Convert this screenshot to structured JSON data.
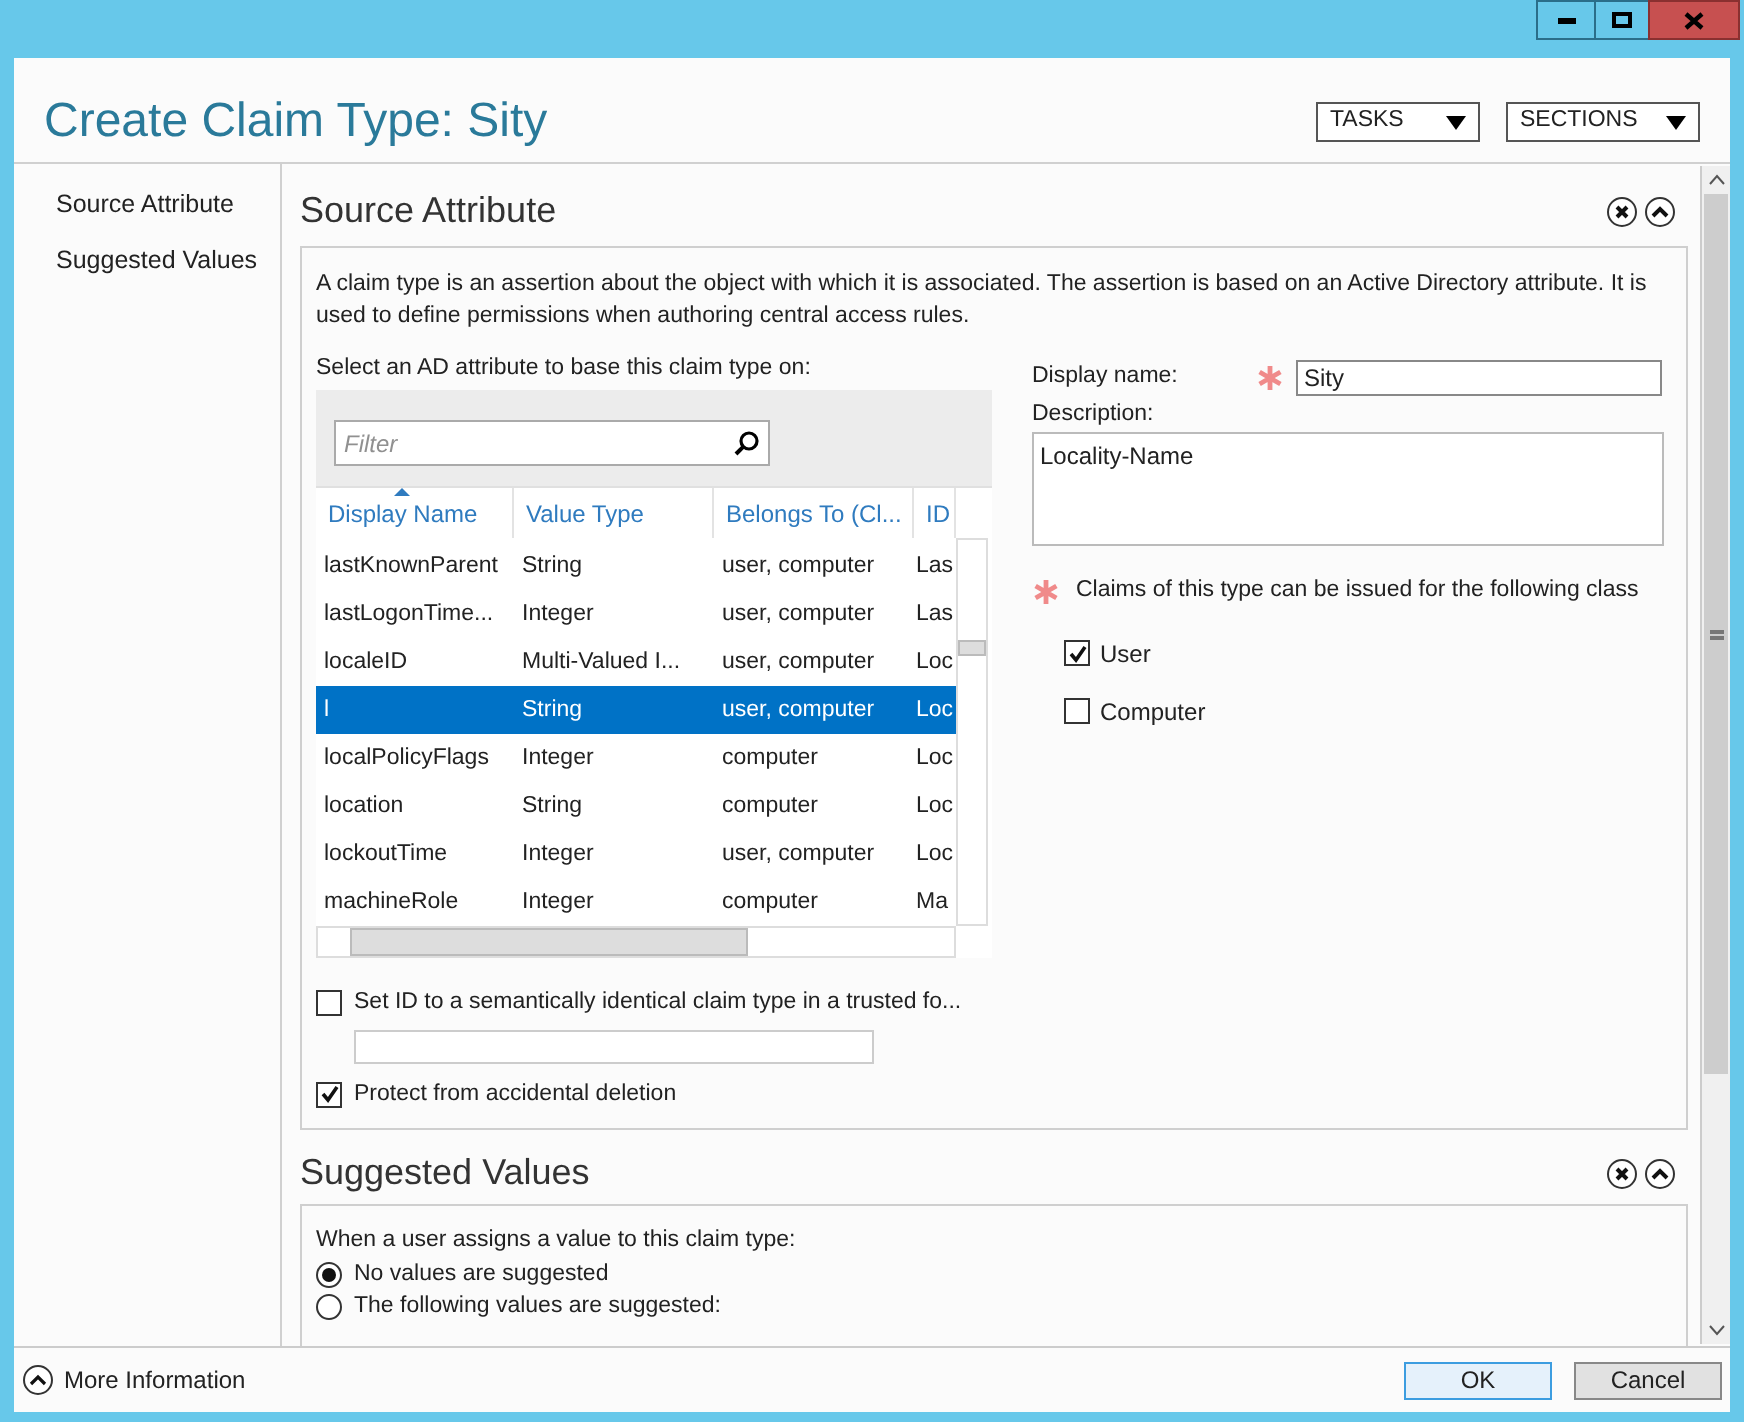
{
  "header": {
    "title": "Create Claim Type: Sity",
    "menus": [
      "TASKS",
      "SECTIONS"
    ]
  },
  "nav": {
    "items": [
      "Source Attribute",
      "Suggested Values"
    ]
  },
  "source_attribute": {
    "heading": "Source Attribute",
    "intro": "A claim type is an assertion about the object with which it is associated. The assertion is based on an Active Directory attribute. It is used to define permissions when authoring central access rules.",
    "select_label": "Select an AD attribute to base this claim type on:",
    "filter_placeholder": "Filter",
    "columns": [
      {
        "label": "Display Name",
        "sorted": true
      },
      {
        "label": "Value Type",
        "sorted": false
      },
      {
        "label": "Belongs To (Cl...",
        "sorted": false
      },
      {
        "label": "ID",
        "sorted": false
      }
    ],
    "rows": [
      {
        "cells": [
          "lastKnownParent",
          "String",
          "user, computer",
          "Las"
        ],
        "selected": false
      },
      {
        "cells": [
          "lastLogonTime...",
          "Integer",
          "user, computer",
          "Las"
        ],
        "selected": false
      },
      {
        "cells": [
          "localeID",
          "Multi-Valued I...",
          "user, computer",
          "Loc"
        ],
        "selected": false
      },
      {
        "cells": [
          "l",
          "String",
          "user, computer",
          "Loc"
        ],
        "selected": true
      },
      {
        "cells": [
          "localPolicyFlags",
          "Integer",
          "computer",
          "Loc"
        ],
        "selected": false
      },
      {
        "cells": [
          "location",
          "String",
          "computer",
          "Loc"
        ],
        "selected": false
      },
      {
        "cells": [
          "lockoutTime",
          "Integer",
          "user, computer",
          "Loc"
        ],
        "selected": false
      },
      {
        "cells": [
          "machineRole",
          "Integer",
          "computer",
          "Ma"
        ],
        "selected": false
      }
    ],
    "set_id": {
      "label": "Set ID to a semantically identical claim type in a trusted fo...",
      "checked": false
    },
    "protect": {
      "label": "Protect from accidental deletion",
      "checked": true
    },
    "display_name_label": "Display name:",
    "display_name_value": "Sity",
    "description_label": "Description:",
    "description_value": "Locality-Name",
    "classes_label": "Claims of this type can be issued for the following class",
    "classes": [
      {
        "label": "User",
        "checked": true
      },
      {
        "label": "Computer",
        "checked": false
      }
    ]
  },
  "suggested_values": {
    "heading": "Suggested Values",
    "prompt": "When a user assigns a value to this claim type:",
    "options": [
      {
        "label": "No values are suggested",
        "selected": true
      },
      {
        "label": "The following values are suggested:",
        "selected": false
      }
    ]
  },
  "footer": {
    "more_info": "More Information",
    "buttons": [
      "OK",
      "Cancel"
    ]
  }
}
